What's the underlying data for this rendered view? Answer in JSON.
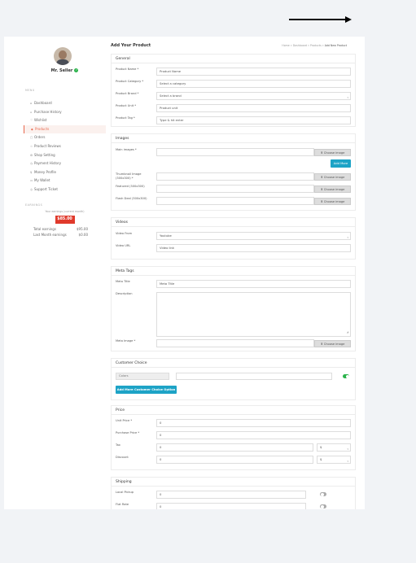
{
  "header": {
    "title": "Add Your Product",
    "breadcrumb": [
      "Home",
      "Dashboard",
      "Products",
      "Add New Product"
    ]
  },
  "seller": {
    "name": "Mr. Seller"
  },
  "sidebar": {
    "section_label": "MENU",
    "items": [
      {
        "label": "Dashboard",
        "icon": "home-icon"
      },
      {
        "label": "Purchase History",
        "icon": "cart-icon"
      },
      {
        "label": "Wishlist",
        "icon": "heart-icon"
      },
      {
        "label": "Products",
        "icon": "diamond-icon",
        "active": true
      },
      {
        "label": "Orders",
        "icon": "file-icon"
      },
      {
        "label": "Product Reviews",
        "icon": "star-icon"
      },
      {
        "label": "Shop Setting",
        "icon": "cog-icon"
      },
      {
        "label": "Payment History",
        "icon": "history-icon"
      },
      {
        "label": "Money Profile",
        "icon": "money-icon"
      },
      {
        "label": "My Wallet",
        "icon": "wallet-icon"
      },
      {
        "label": "Support Ticket",
        "icon": "support-icon"
      }
    ],
    "earnings": {
      "section_label": "EARNINGS",
      "note": "Your earnings (current month)",
      "amount": "$85.00",
      "total_label": "Total earnings",
      "total_value": "$95.00",
      "last_label": "Last Month earnings",
      "last_value": "$0.00"
    }
  },
  "general": {
    "title": "General",
    "fields": [
      {
        "label": "Product Name *",
        "value": "Product Name"
      },
      {
        "label": "Product Category *",
        "value": "Select a category"
      },
      {
        "label": "Product Brand *",
        "value": "Select a brand"
      },
      {
        "label": "Product Unit *",
        "value": "Product unit"
      },
      {
        "label": "Product Tag *",
        "value": "Type & hit enter"
      }
    ]
  },
  "images": {
    "title": "Images",
    "main_label": "Main images *",
    "add_more": "Add More",
    "thumb_label": "Thumbnail Image (300x300) *",
    "featured_label": "Featured (300x300)",
    "flash_label": "Flash Deal (300x300)",
    "choose": "Choose image"
  },
  "videos": {
    "title": "Videos",
    "from_label": "Video From",
    "from_value": "Youtube",
    "url_label": "Video URL",
    "url_value": "Video link"
  },
  "meta": {
    "title": "Meta Tags",
    "meta_title_label": "Meta Title",
    "meta_title_value": "Meta Title",
    "description_label": "Description",
    "meta_image_label": "Meta Image *",
    "choose": "Choose image"
  },
  "choice": {
    "title": "Customer Choice",
    "tag": "Colors",
    "add_button": "Add More Customer Choice Option"
  },
  "price": {
    "title": "Price",
    "unit_label": "Unit Price *",
    "unit_value": "0",
    "purchase_label": "Purchase Price *",
    "purchase_value": "0",
    "tax_label": "Tax",
    "tax_value": "0",
    "tax_type": "$",
    "discount_label": "Discount",
    "discount_value": "0",
    "discount_type": "$"
  },
  "shipping": {
    "title": "Shipping",
    "local_label": "Local Pickup",
    "local_value": "0",
    "flat_label": "Flat Rate",
    "flat_value": "0"
  }
}
